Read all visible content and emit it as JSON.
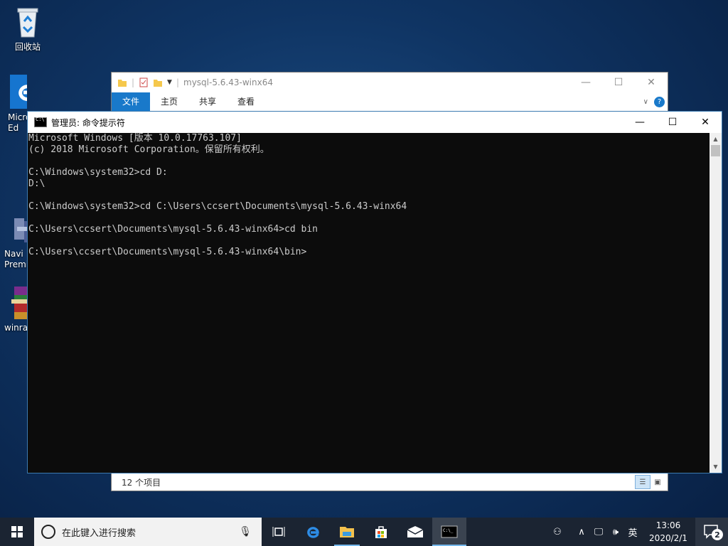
{
  "desktop": {
    "icons": [
      {
        "label": "回收站",
        "icon": "recycle-bin-icon"
      },
      {
        "label": "Micro\nEd",
        "icon": "edge-icon"
      },
      {
        "label": "Navi\nPremi",
        "icon": "app-icon"
      },
      {
        "label": "winra",
        "icon": "winrar-icon"
      }
    ]
  },
  "explorer": {
    "title": "mysql-5.6.43-winx64",
    "tabs": [
      "文件",
      "主页",
      "共享",
      "查看"
    ],
    "status": "12 个项目"
  },
  "cmd": {
    "title": "管理员: 命令提示符",
    "lines": [
      "Microsoft Windows [版本 10.0.17763.107]",
      "(c) 2018 Microsoft Corporation。保留所有权利。",
      "",
      "C:\\Windows\\system32>cd D:",
      "D:\\",
      "",
      "C:\\Windows\\system32>cd C:\\Users\\ccsert\\Documents\\mysql-5.6.43-winx64",
      "",
      "C:\\Users\\ccsert\\Documents\\mysql-5.6.43-winx64>cd bin",
      "",
      "C:\\Users\\ccsert\\Documents\\mysql-5.6.43-winx64\\bin>"
    ]
  },
  "taskbar": {
    "search_placeholder": "在此键入进行搜索",
    "tray": {
      "ime": "英",
      "time": "13:06",
      "date": "2020/2/1",
      "notification_count": "2"
    }
  },
  "colors": {
    "accent": "#1979ca",
    "taskbar_indicator": "#76b9ed",
    "console_bg": "#0c0c0c",
    "console_fg": "#cccccc"
  }
}
